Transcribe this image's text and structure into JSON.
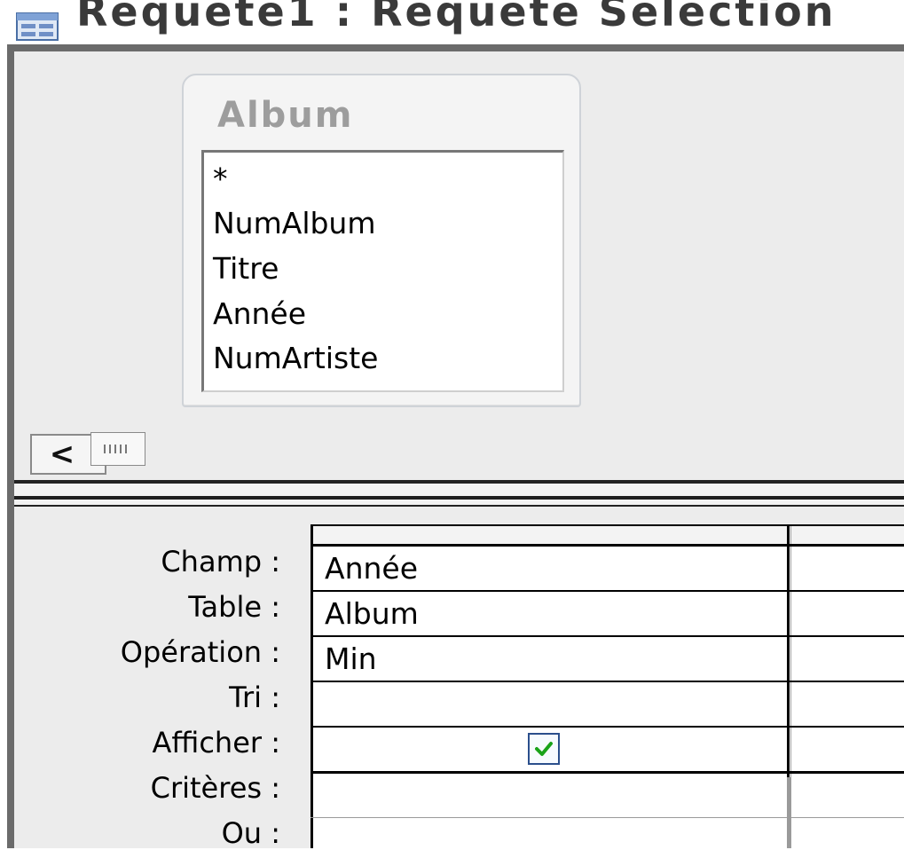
{
  "window": {
    "title": "Requete1 : Requete Selection"
  },
  "field_list": {
    "table_name": "Album",
    "fields": [
      "*",
      "NumAlbum",
      "Titre",
      "Année",
      "NumArtiste"
    ]
  },
  "scrollbar": {
    "left_arrow_glyph": "<"
  },
  "design_grid": {
    "row_labels": {
      "champ": "Champ :",
      "table": "Table :",
      "operation": "Opération :",
      "tri": "Tri :",
      "afficher": "Afficher :",
      "criteres": "Critères :",
      "ou": "Ou :"
    },
    "column1": {
      "champ": "Année",
      "table": "Album",
      "operation": "Min",
      "tri": "",
      "afficher": true,
      "criteres": "",
      "ou": ""
    }
  },
  "icons": {
    "title": "query-window-icon",
    "scroll_left": "left-arrow-icon",
    "checkbox": "checkmark-icon"
  },
  "colors": {
    "checkmark": "#1aa31a",
    "checkbox_border": "#2b4f8c",
    "field_list_title": "#9d9d9d"
  }
}
